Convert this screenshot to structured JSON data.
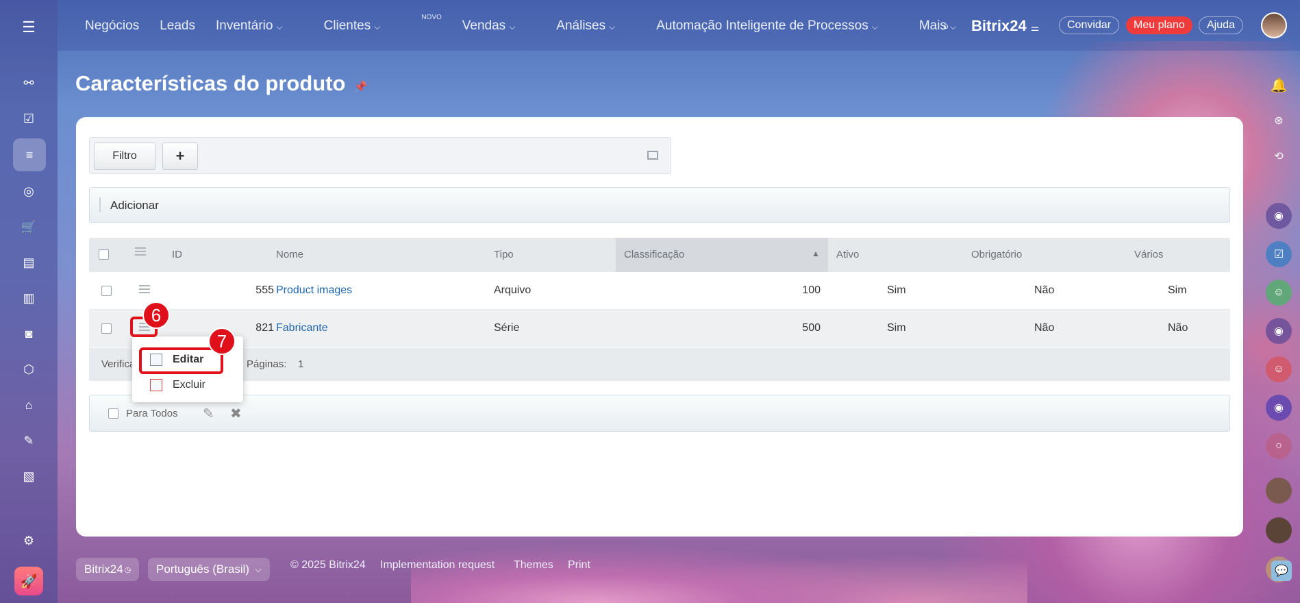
{
  "topnav": {
    "items": [
      "Negócios",
      "Leads",
      "Inventário",
      "Clientes",
      "Vendas",
      "Análises",
      "Automação Inteligente de Processos",
      "Mais"
    ],
    "novo_badge": "NOVO",
    "brand": "Bitrix24",
    "invite": "Convidar",
    "plan": "Meu plano",
    "help": "Ajuda"
  },
  "page": {
    "title": "Características do produto"
  },
  "filter": {
    "filter_label": "Filtro",
    "add_label": "+"
  },
  "actions": {
    "add_label": "Adicionar"
  },
  "table": {
    "headers": [
      "ID",
      "Nome",
      "Tipo",
      "Classificação",
      "Ativo",
      "Obrigatório",
      "Vários"
    ],
    "rows": [
      {
        "id": "555",
        "name": "Product images",
        "type": "Arquivo",
        "sort": "100",
        "active": "Sim",
        "required": "Não",
        "multiple": "Sim"
      },
      {
        "id": "821",
        "name": "Fabricante",
        "type": "Série",
        "sort": "500",
        "active": "Sim",
        "required": "Não",
        "multiple": "Não"
      }
    ],
    "footer_checked": "Verifica",
    "footer_pages_label": "Páginas:",
    "footer_pages": "1"
  },
  "context_menu": {
    "edit": "Editar",
    "delete": "Excluir"
  },
  "bulk": {
    "for_all": "Para Todos"
  },
  "annotations": {
    "step6": "6",
    "step7": "7"
  },
  "footer": {
    "brand": "Bitrix24",
    "language": "Português (Brasil)",
    "copyright": "© 2025 Bitrix24",
    "impl": "Implementation request",
    "themes": "Themes",
    "print": "Print"
  },
  "colors": {
    "accent_red": "#e0101b",
    "link_blue": "#2067b0",
    "plan_red": "#ef3b3b"
  }
}
